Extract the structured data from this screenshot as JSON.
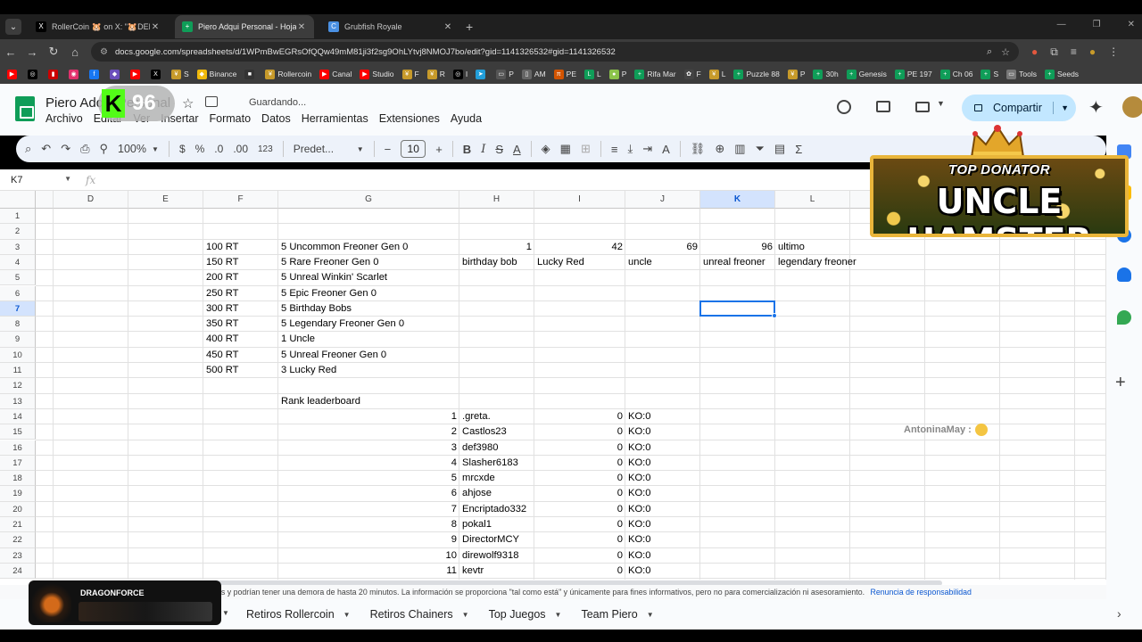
{
  "browser": {
    "tabs": [
      {
        "title": "RollerCoin 🐹 on X: \"🐹DEEP D",
        "favicon": "X",
        "color": "#000000"
      },
      {
        "title": "Piero Adqui Personal - Hojas de",
        "favicon": "+",
        "color": "#0f9d58"
      },
      {
        "title": "Grubfish Royale",
        "favicon": "C",
        "color": "#4a90e2"
      }
    ],
    "new_tab": "+",
    "url": "docs.google.com/spreadsheets/d/1WPmBwEGRsOfQQw49mM81ji3f2sg9OhLYtvj8NMOJ7bo/edit?gid=1141326532#gid=1141326532",
    "bookmarks": [
      {
        "label": "",
        "color": "#ff0000",
        "icon": "▶"
      },
      {
        "label": "",
        "color": "#000000",
        "icon": "◎"
      },
      {
        "label": "",
        "color": "#cc0000",
        "icon": "▮"
      },
      {
        "label": "",
        "color": "#e1306c",
        "icon": "◉"
      },
      {
        "label": "",
        "color": "#1877f2",
        "icon": "f"
      },
      {
        "label": "",
        "color": "#6b4fbb",
        "icon": "◆"
      },
      {
        "label": "",
        "color": "#ff0000",
        "icon": "▶"
      },
      {
        "label": "",
        "color": "#000000",
        "icon": "X"
      },
      {
        "label": "S",
        "color": "#c79a2a",
        "icon": "¥"
      },
      {
        "label": "Binance",
        "color": "#f0b90b",
        "icon": "◆"
      },
      {
        "label": "",
        "color": "#333333",
        "icon": "■"
      },
      {
        "label": "Rollercoin",
        "color": "#c79a2a",
        "icon": "¥"
      },
      {
        "label": "Canal",
        "color": "#ff0000",
        "icon": "▶"
      },
      {
        "label": "Studio",
        "color": "#ff0000",
        "icon": "▶"
      },
      {
        "label": "F",
        "color": "#c79a2a",
        "icon": "¥"
      },
      {
        "label": "R",
        "color": "#c79a2a",
        "icon": "¥"
      },
      {
        "label": "I",
        "color": "#000000",
        "icon": "◎"
      },
      {
        "label": "",
        "color": "#229ed9",
        "icon": "➤"
      },
      {
        "label": "P",
        "color": "#555555",
        "icon": "▭"
      },
      {
        "label": "AM",
        "color": "#666666",
        "icon": "▯"
      },
      {
        "label": "PE",
        "color": "#d35400",
        "icon": "π"
      },
      {
        "label": "L",
        "color": "#0f9d58",
        "icon": "L"
      },
      {
        "label": "P",
        "color": "#8bc34a",
        "icon": "●"
      },
      {
        "label": "Rifa Mar",
        "color": "#0f9d58",
        "icon": "+"
      },
      {
        "label": "F",
        "color": "#444444",
        "icon": "✿"
      },
      {
        "label": "L",
        "color": "#c79a2a",
        "icon": "¥"
      },
      {
        "label": "Puzzle 88",
        "color": "#0f9d58",
        "icon": "+"
      },
      {
        "label": "P",
        "color": "#c79a2a",
        "icon": "¥"
      },
      {
        "label": "30h",
        "color": "#0f9d58",
        "icon": "+"
      },
      {
        "label": "Genesis",
        "color": "#0f9d58",
        "icon": "+"
      },
      {
        "label": "PE 197",
        "color": "#0f9d58",
        "icon": "+"
      },
      {
        "label": "Ch 06",
        "color": "#0f9d58",
        "icon": "+"
      },
      {
        "label": "S",
        "color": "#0f9d58",
        "icon": "+"
      },
      {
        "label": "Tools",
        "color": "#777777",
        "icon": "▭"
      },
      {
        "label": "Seeds",
        "color": "#0f9d58",
        "icon": "+"
      }
    ]
  },
  "sheets": {
    "doc_title": "Piero Adqui Personal",
    "saving_status": "Guardando...",
    "menu": [
      "Archivo",
      "Editar",
      "Ver",
      "Insertar",
      "Formato",
      "Datos",
      "Herramientas",
      "Extensiones",
      "Ayuda"
    ],
    "share_label": "Compartir",
    "zoom": "100%",
    "currency": "$",
    "percent": "%",
    "dec_less": ".0",
    "dec_more": ".00",
    "number_format": "123",
    "font_name": "Predet...",
    "font_size": "10",
    "name_box": "K7",
    "fx": "fx",
    "columns": [
      "D",
      "E",
      "F",
      "G",
      "H",
      "I",
      "J",
      "K",
      "L"
    ],
    "selected_column": "K",
    "selected_row": "7",
    "rows": [
      "1",
      "2",
      "3",
      "4",
      "5",
      "6",
      "7",
      "8",
      "9",
      "10",
      "11",
      "12",
      "13",
      "14",
      "15",
      "16",
      "17",
      "18",
      "19",
      "20",
      "21",
      "22",
      "23",
      "24"
    ],
    "cells": {
      "F3": "100 RT",
      "F4": "150 RT",
      "F5": "200 RT",
      "F6": "250 RT",
      "F7": "300 RT",
      "F8": "350 RT",
      "F9": "400 RT",
      "F10": "450 RT",
      "F11": "500 RT",
      "G3": "5 Uncommon Freoner Gen 0",
      "G4": "5 Rare Freoner Gen 0",
      "G5": "5 Unreal Winkin' Scarlet",
      "G6": "5 Epic Freoner Gen 0",
      "G7": "5 Birthday Bobs",
      "G8": "5 Legendary Freoner Gen 0",
      "G9": "1 Uncle",
      "G10": "5 Unreal Freoner Gen 0",
      "G11": "3 Lucky Red",
      "G13": "Rank leaderboard",
      "H3": "1",
      "I3": "42",
      "J3": "69",
      "K3": "96",
      "L3": "ultimo",
      "H4": "birthday bob",
      "I4": "Lucky Red",
      "J4": "uncle",
      "K4": "unreal freoner",
      "L4": "legendary freoner"
    },
    "leaderboard": [
      {
        "rank": "1",
        "name": ".greta.",
        "score": "0",
        "ko": "KO:0"
      },
      {
        "rank": "2",
        "name": "Castlos23",
        "score": "0",
        "ko": "KO:0"
      },
      {
        "rank": "3",
        "name": "def3980",
        "score": "0",
        "ko": "KO:0"
      },
      {
        "rank": "4",
        "name": "Slasher6183",
        "score": "0",
        "ko": "KO:0"
      },
      {
        "rank": "5",
        "name": "mrcxde",
        "score": "0",
        "ko": "KO:0"
      },
      {
        "rank": "6",
        "name": "ahjose",
        "score": "0",
        "ko": "KO:0"
      },
      {
        "rank": "7",
        "name": "Encriptado332",
        "score": "0",
        "ko": "KO:0"
      },
      {
        "rank": "8",
        "name": "pokal1",
        "score": "0",
        "ko": "KO:0"
      },
      {
        "rank": "9",
        "name": "DirectorMCY",
        "score": "0",
        "ko": "KO:0"
      },
      {
        "rank": "10",
        "name": "direwolf9318",
        "score": "0",
        "ko": "KO:0"
      },
      {
        "rank": "11",
        "name": "kevtr",
        "score": "0",
        "ko": "KO:0"
      }
    ],
    "disclaimer": "os y podrían tener una demora de hasta 20 minutos. La información se proporciona \"tal como está\" y únicamente para fines informativos, pero no para comercialización ni asesoramiento.",
    "disclaimer_link": "Renuncia de responsabilidad",
    "sheet_tabs": [
      "Retiros Rollercoin",
      "Retiros Chainers",
      "Top Juegos",
      "Team Piero"
    ]
  },
  "overlays": {
    "kick_letter": "K",
    "kick_count": "96",
    "donator_top": "TOP DONATOR",
    "donator_name": "UNCLE HAMSTER",
    "stream_label": "DRAGONFORCE",
    "cursor_user": "AntoninaMay :"
  },
  "colors": {
    "accent": "#1a73e8",
    "share_bg": "#c2e7ff",
    "sheets_green": "#0f9d58",
    "kick_green": "#53fc18"
  }
}
